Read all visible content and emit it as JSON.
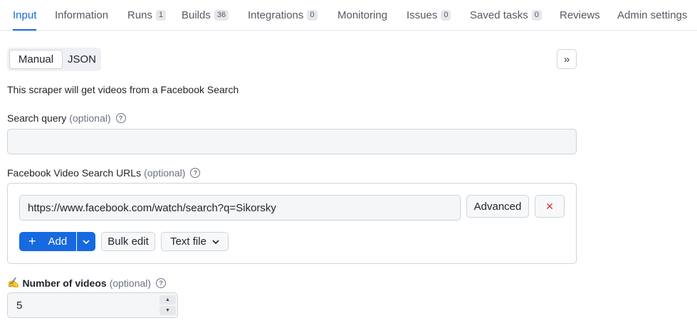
{
  "tabs": [
    {
      "label": "Input",
      "badge": ""
    },
    {
      "label": "Information",
      "badge": ""
    },
    {
      "label": "Runs",
      "badge": "1"
    },
    {
      "label": "Builds",
      "badge": "36"
    },
    {
      "label": "Integrations",
      "badge": "0"
    },
    {
      "label": "Monitoring",
      "badge": ""
    },
    {
      "label": "Issues",
      "badge": "0"
    },
    {
      "label": "Saved tasks",
      "badge": "0"
    },
    {
      "label": "Reviews",
      "badge": ""
    },
    {
      "label": "Admin settings",
      "badge": ""
    }
  ],
  "mode": {
    "manual": "Manual",
    "json": "JSON",
    "selected": "Manual"
  },
  "collapse_icon": "»",
  "description": "This scraper will get videos from a Facebook Search",
  "search_query": {
    "label": "Search query",
    "optional": "(optional)",
    "value": ""
  },
  "search_urls": {
    "label": "Facebook Video Search URLs",
    "optional": "(optional)",
    "url": "https://www.facebook.com/watch/search?q=Sikorsky",
    "advanced": "Advanced",
    "remove_icon": "✕",
    "add": "Add",
    "add_icon": "+",
    "bulk_edit": "Bulk edit",
    "text_file": "Text file"
  },
  "num_videos": {
    "emoji": "✍️",
    "label": "Number of videos",
    "optional": "(optional)",
    "value": "5"
  },
  "colors": {
    "accent": "#1669e0",
    "remove": "#e03131"
  }
}
